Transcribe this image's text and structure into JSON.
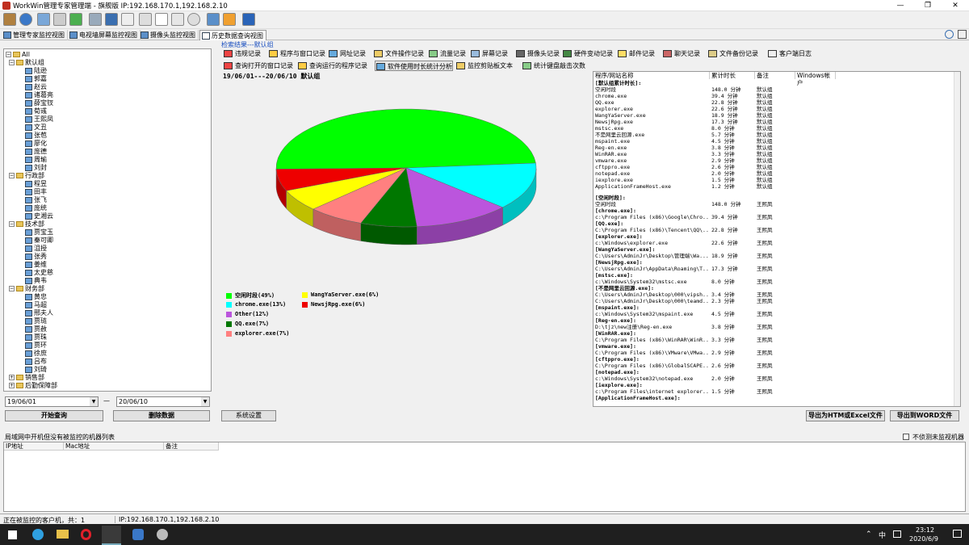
{
  "window": {
    "title": "WorkWin管理专家管理端 - 旗舰版 IP:192.168.170.1,192.168.2.10",
    "minimize": "—",
    "maximize": "❐",
    "close": "✕"
  },
  "tabs": [
    {
      "label": "管理专家监控视图"
    },
    {
      "label": "电视墙屏幕监控视图"
    },
    {
      "label": "摄像头监控视图"
    },
    {
      "label": "历史数据查询视图"
    }
  ],
  "tree": {
    "root": "All",
    "groups": [
      {
        "name": "默认组",
        "members": [
          "陆逊",
          "郭嘉",
          "赵云",
          "诸葛亮",
          "薛宝钗",
          "荀彧",
          "王熙凤",
          "文丑",
          "张苞",
          "廖化",
          "庞德",
          "周瑜",
          "刘封"
        ]
      },
      {
        "name": "行政部",
        "members": [
          "程昱",
          "田丰",
          "张飞",
          "庞统",
          "史湘云"
        ]
      },
      {
        "name": "技术部",
        "members": [
          "贾宝玉",
          "秦可卿",
          "沮授",
          "张秀",
          "姜维",
          "太史慈",
          "典韦"
        ]
      },
      {
        "name": "财务部",
        "members": [
          "黄忠",
          "马超",
          "邢夫人",
          "贾琏",
          "贾赦",
          "贾珠",
          "贾环",
          "徐庶",
          "吕布",
          "刘琦"
        ]
      },
      {
        "name": "销售部",
        "members": []
      },
      {
        "name": "后勤保障部",
        "members": []
      }
    ]
  },
  "dates": {
    "from": "19/06/01",
    "to": "20/06/10",
    "dash": "—"
  },
  "buttons": {
    "start": "开始查询",
    "delete": "删除数据",
    "settings": "系统设置",
    "export_excel": "导出为HTM或Excel文件",
    "export_word": "导出到WORD文件"
  },
  "search_result_label": "检索结果---默认组",
  "record_tools_row1": [
    "违规记录",
    "程序与窗口记录",
    "网址记录",
    "文件操作记录",
    "流量记录",
    "屏幕记录",
    "摄像头记录",
    "硬件变动记录",
    "邮件记录",
    "聊天记录",
    "文件备份记录",
    "客户端日志"
  ],
  "record_tools_row2": [
    "查询打开的窗口记录",
    "查询运行的程序记录",
    "软件使用时长统计分析",
    "监控剪贴板文本",
    "统计键盘敲击次数"
  ],
  "chart_header": "19/06/01---20/06/10   默认组",
  "chart_data": {
    "type": "pie",
    "title": "",
    "slices": [
      {
        "label": "空闲时段(49%)",
        "value": 49,
        "color": "#00ff00"
      },
      {
        "label": "chrome.exe(13%)",
        "value": 13,
        "color": "#00ffff"
      },
      {
        "label": "Other(12%)",
        "value": 12,
        "color": "#bb55dd"
      },
      {
        "label": "QQ.exe(7%)",
        "value": 7,
        "color": "#007700"
      },
      {
        "label": "explorer.exe(7%)",
        "value": 7,
        "color": "#ff8080"
      },
      {
        "label": "WangYaServer.exe(6%)",
        "value": 6,
        "color": "#ffff00"
      },
      {
        "label": "NewsjRpg.exe(6%)",
        "value": 6,
        "color": "#ee0000"
      }
    ]
  },
  "table": {
    "headers": [
      "程序/网站名称",
      "累计时长",
      "备注",
      "Windows帐户"
    ],
    "summary_title": "[默认组累计时长]:",
    "summary": [
      [
        "空闲时段",
        "148.0 分钟",
        "默认组"
      ],
      [
        "chrome.exe",
        "39.4 分钟",
        "默认组"
      ],
      [
        "QQ.exe",
        "22.8 分钟",
        "默认组"
      ],
      [
        "explorer.exe",
        "22.6 分钟",
        "默认组"
      ],
      [
        "WangYaServer.exe",
        "18.9 分钟",
        "默认组"
      ],
      [
        "NewsjRpg.exe",
        "17.3 分钟",
        "默认组"
      ],
      [
        "mstsc.exe",
        "8.0 分钟",
        "默认组"
      ],
      [
        "不是网里云回源.exe",
        "5.7 分钟",
        "默认组"
      ],
      [
        "mspaint.exe",
        "4.5 分钟",
        "默认组"
      ],
      [
        "Reg-en.exe",
        "3.8 分钟",
        "默认组"
      ],
      [
        "WinRAR.exe",
        "3.3 分钟",
        "默认组"
      ],
      [
        "vmware.exe",
        "2.9 分钟",
        "默认组"
      ],
      [
        "cftppro.exe",
        "2.6 分钟",
        "默认组"
      ],
      [
        "notepad.exe",
        "2.0 分钟",
        "默认组"
      ],
      [
        "iexplore.exe",
        "1.5 分钟",
        "默认组"
      ],
      [
        "ApplicationFrameHost.exe",
        "1.2 分钟",
        "默认组"
      ]
    ],
    "details": [
      [
        "[空闲时段]:",
        "",
        ""
      ],
      [
        "空闲时段",
        "148.0 分钟",
        "王熙凤"
      ],
      [
        "[chrome.exe]:",
        "",
        ""
      ],
      [
        "c:\\Program Files (x86)\\Google\\Chro...",
        "39.4 分钟",
        "王熙凤"
      ],
      [
        "[QQ.exe]:",
        "",
        ""
      ],
      [
        "C:\\Program Files (x86)\\Tencent\\QQ\\...",
        "22.8 分钟",
        "王熙凤"
      ],
      [
        "[explorer.exe]:",
        "",
        ""
      ],
      [
        "c:\\Windows\\explorer.exe",
        "22.6 分钟",
        "王熙凤"
      ],
      [
        "[WangYaServer.exe]:",
        "",
        ""
      ],
      [
        "C:\\Users\\AdminJr\\Desktop\\管理端\\Wa...",
        "18.9 分钟",
        "王熙凤"
      ],
      [
        "[NewsjRpg.exe]:",
        "",
        ""
      ],
      [
        "C:\\Users\\AdminJr\\AppData\\Roaming\\T...",
        "17.3 分钟",
        "王熙凤"
      ],
      [
        "[mstsc.exe]:",
        "",
        ""
      ],
      [
        "c:\\Windows\\System32\\mstsc.exe",
        "8.0 分钟",
        "王熙凤"
      ],
      [
        "[不是网里云回源.exe]:",
        "",
        ""
      ],
      [
        "C:\\Users\\AdminJr\\Desktop\\000\\vipsh...",
        "3.4 分钟",
        "王熙凤"
      ],
      [
        "C:\\Users\\AdminJr\\Desktop\\000\\teamd...",
        "2.3 分钟",
        "王熙凤"
      ],
      [
        "[mspaint.exe]:",
        "",
        ""
      ],
      [
        "c:\\Windows\\System32\\mspaint.exe",
        "4.5 分钟",
        "王熙凤"
      ],
      [
        "[Reg-en.exe]:",
        "",
        ""
      ],
      [
        "D:\\tjz\\new注册\\Reg-en.exe",
        "3.8 分钟",
        "王熙凤"
      ],
      [
        "[WinRAR.exe]:",
        "",
        ""
      ],
      [
        "C:\\Program Files (x86)\\WinRAR\\WinR...",
        "3.3 分钟",
        "王熙凤"
      ],
      [
        "[vmware.exe]:",
        "",
        ""
      ],
      [
        "C:\\Program Files (x86)\\VMware\\VMwa...",
        "2.9 分钟",
        "王熙凤"
      ],
      [
        "[cftppro.exe]:",
        "",
        ""
      ],
      [
        "C:\\Program Files (x86)\\GlobalSCAPE...",
        "2.6 分钟",
        "王熙凤"
      ],
      [
        "[notepad.exe]:",
        "",
        ""
      ],
      [
        "c:\\Windows\\System32\\notepad.exe",
        "2.0 分钟",
        "王熙凤"
      ],
      [
        "[iexplore.exe]:",
        "",
        ""
      ],
      [
        "c:\\Program Files\\internet explorer...",
        "1.5 分钟",
        "王熙凤"
      ],
      [
        "[ApplicationFrameHost.exe]:",
        "",
        ""
      ]
    ]
  },
  "lan_panel": {
    "title": "局域网中开机但没有被监控的机器列表",
    "checkbox_label": "不侦测未监视机器",
    "headers": [
      "IP地址",
      "Mac地址",
      "备注"
    ]
  },
  "status": {
    "left": "正在被监控的客户机，共：1",
    "right": "IP:192.168.170.1,192.168.2.10"
  },
  "taskbar": {
    "ime": "中",
    "time": "23:12",
    "date": "2020/6/9"
  }
}
